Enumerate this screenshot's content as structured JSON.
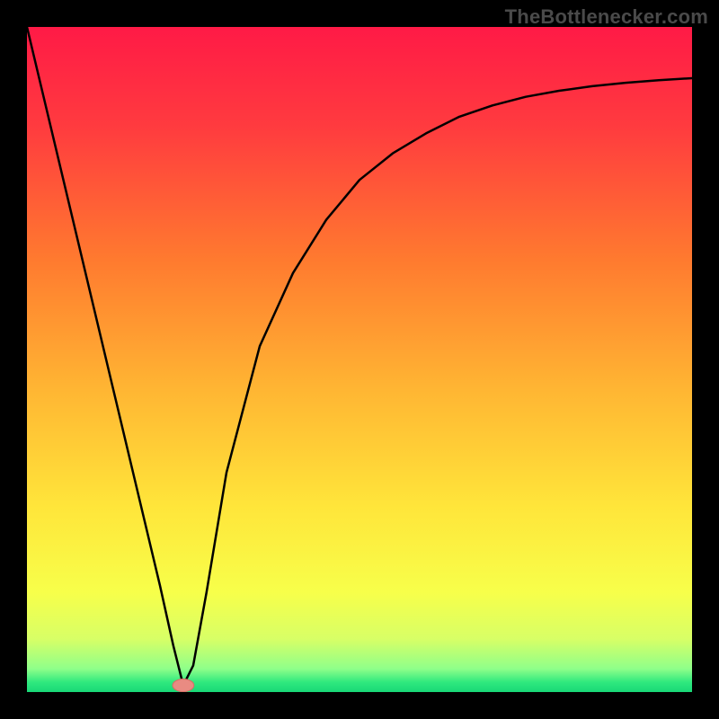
{
  "watermark": "TheBottlenecker.com",
  "chart_data": {
    "type": "line",
    "title": "",
    "xlabel": "",
    "ylabel": "",
    "xlim": [
      0,
      100
    ],
    "ylim": [
      0,
      100
    ],
    "gradient_stops": [
      {
        "offset": 0,
        "color": "#ff1a46"
      },
      {
        "offset": 0.15,
        "color": "#ff3b3f"
      },
      {
        "offset": 0.35,
        "color": "#ff7a2f"
      },
      {
        "offset": 0.55,
        "color": "#ffb733"
      },
      {
        "offset": 0.72,
        "color": "#ffe53a"
      },
      {
        "offset": 0.85,
        "color": "#f7ff4a"
      },
      {
        "offset": 0.92,
        "color": "#d8ff66"
      },
      {
        "offset": 0.965,
        "color": "#8fff8a"
      },
      {
        "offset": 0.985,
        "color": "#30e97e"
      },
      {
        "offset": 1.0,
        "color": "#18d877"
      }
    ],
    "series": [
      {
        "name": "bottleneck-curve",
        "x": [
          0,
          5,
          10,
          15,
          20,
          22,
          23.5,
          25,
          27,
          30,
          35,
          40,
          45,
          50,
          55,
          60,
          65,
          70,
          75,
          80,
          85,
          90,
          95,
          100
        ],
        "y": [
          100,
          79,
          58,
          37,
          16,
          7,
          1,
          4,
          15,
          33,
          52,
          63,
          71,
          77,
          81,
          84,
          86.5,
          88.2,
          89.5,
          90.4,
          91.1,
          91.6,
          92,
          92.3
        ]
      }
    ],
    "marker": {
      "name": "min-marker",
      "x": 23.5,
      "y": 1,
      "rx": 1.6,
      "ry": 0.95,
      "fill": "#e98b82",
      "stroke": "#d76f66"
    }
  }
}
